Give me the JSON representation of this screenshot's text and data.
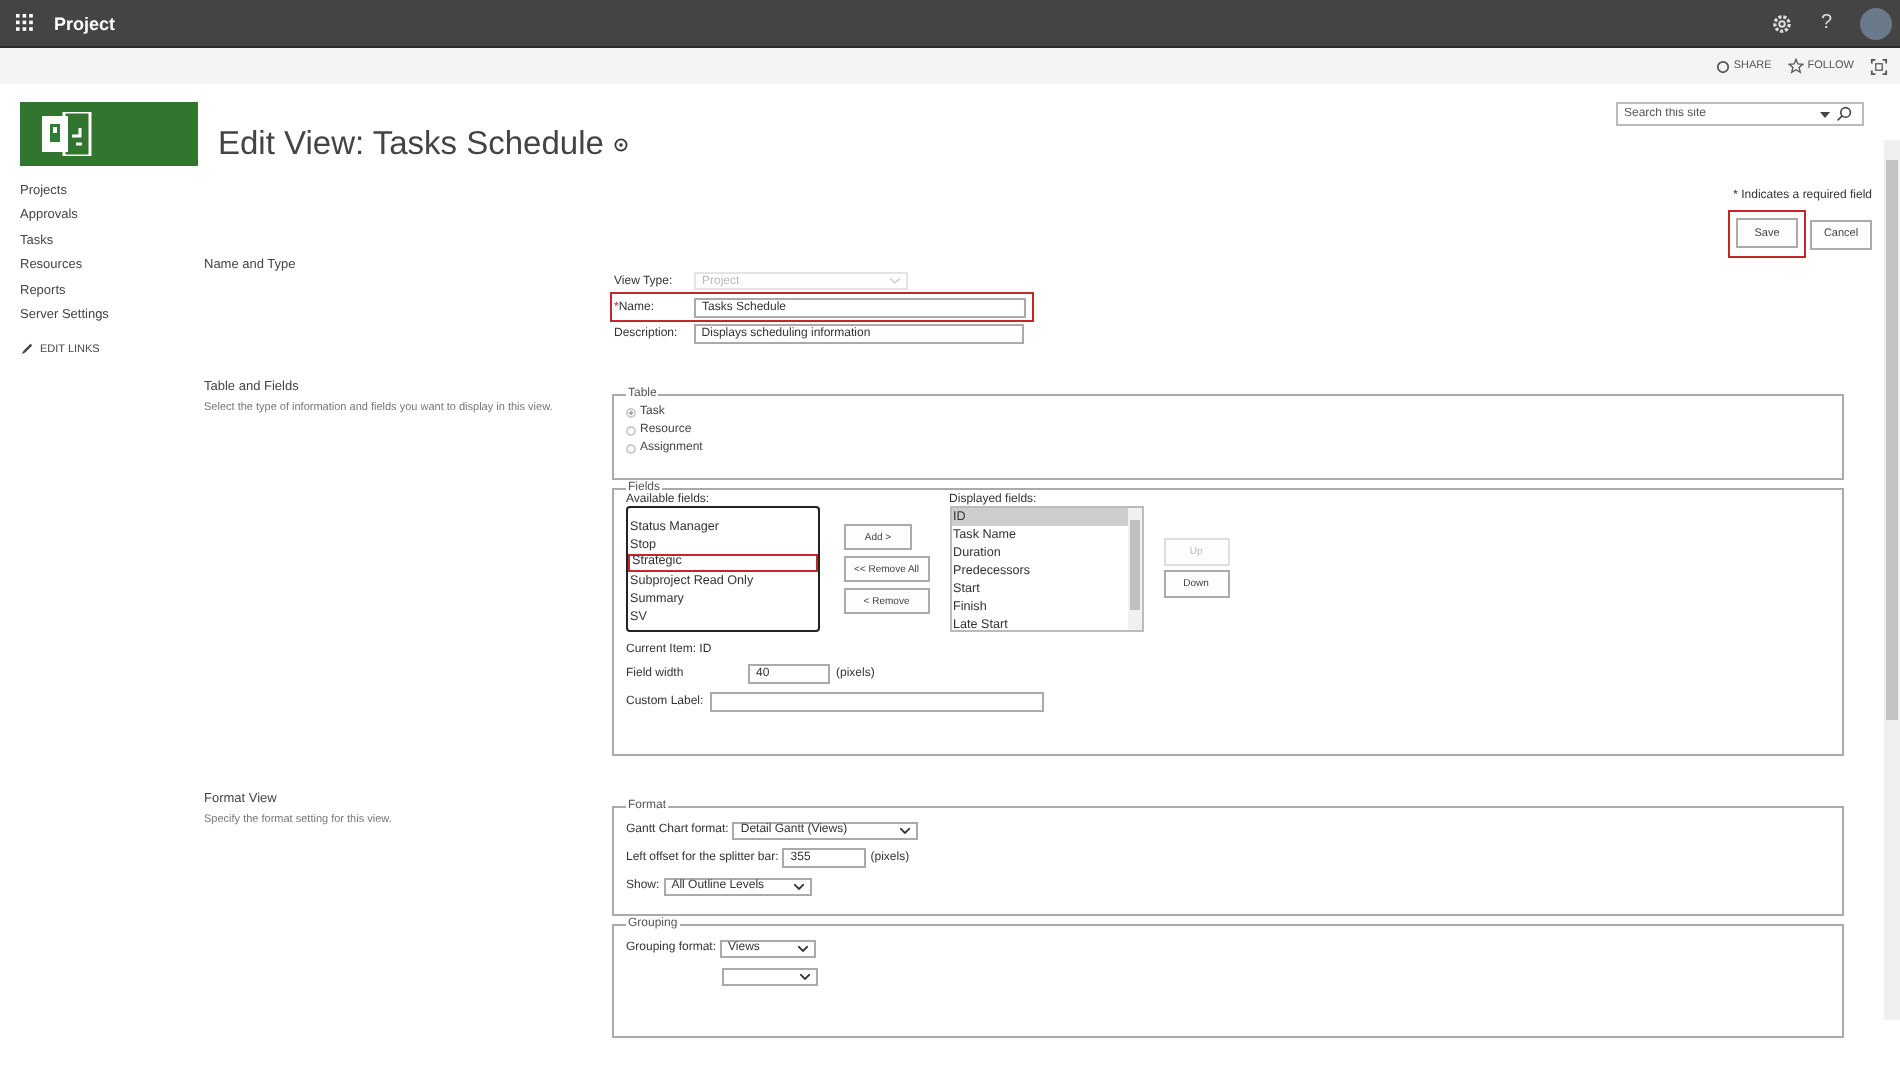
{
  "top_bar": {
    "app_name": "Project",
    "help_label": "?"
  },
  "suite_bar": {
    "actions": [
      {
        "kind": "share",
        "label": "SHARE"
      },
      {
        "kind": "follow",
        "label": "FOLLOW"
      },
      {
        "kind": "focus"
      }
    ]
  },
  "search": {
    "placeholder": "Search this site"
  },
  "page_title": "Edit View: Tasks Schedule",
  "nav": {
    "items": [
      "Projects",
      "Approvals",
      "Tasks",
      "Resources",
      "Reports",
      "Server Settings"
    ],
    "edit_links": "EDIT LINKS"
  },
  "required_note": "* Indicates a required field",
  "buttons": [
    {
      "label": "Save",
      "highlighted": true
    },
    {
      "label": "Cancel",
      "highlighted": false
    }
  ],
  "name_and_type": {
    "heading": "Name and Type",
    "view_type_label": "View Type:",
    "view_type_value": "Project",
    "view_type_disabled": true,
    "name_label": "Name:",
    "name_required_mark": "*",
    "name_value": "Tasks Schedule",
    "name_highlighted": true,
    "description_label": "Description:",
    "description_value": "Displays scheduling information"
  },
  "table_and_fields": {
    "heading": "Table and Fields",
    "description": "Select the type of information and fields you want to display in this view.",
    "table_legend": "Table",
    "table_options": [
      {
        "label": "Task",
        "selected": true
      },
      {
        "label": "Resource",
        "selected": false
      },
      {
        "label": "Assignment",
        "selected": false
      }
    ],
    "fields_legend": "Fields",
    "available_label": "Available fields:",
    "available_fields": [
      {
        "label": "Status Manager",
        "selected": false,
        "highlighted": false
      },
      {
        "label": "Stop",
        "selected": false,
        "highlighted": false
      },
      {
        "label": "Strategic",
        "selected": false,
        "highlighted": true
      },
      {
        "label": "Subproject Read Only",
        "selected": false,
        "highlighted": false
      },
      {
        "label": "Summary",
        "selected": false,
        "highlighted": false
      },
      {
        "label": "SV",
        "selected": false,
        "highlighted": false
      }
    ],
    "move_buttons": [
      "Add >",
      "<< Remove All",
      "< Remove"
    ],
    "displayed_label": "Displayed fields:",
    "displayed_fields": [
      {
        "label": "ID",
        "selected": true
      },
      {
        "label": "Task Name",
        "selected": false
      },
      {
        "label": "Duration",
        "selected": false
      },
      {
        "label": "Predecessors",
        "selected": false
      },
      {
        "label": "Start",
        "selected": false
      },
      {
        "label": "Finish",
        "selected": false
      },
      {
        "label": "Late Start",
        "selected": false
      }
    ],
    "order_buttons": [
      {
        "label": "Up",
        "disabled": true
      },
      {
        "label": "Down",
        "disabled": false
      }
    ],
    "current_item": "Current Item: ID",
    "field_width_label": "Field width",
    "field_width_value": "40",
    "field_width_unit": "(pixels)",
    "custom_label": "Custom Label:"
  },
  "format_view": {
    "heading": "Format View",
    "description": "Specify the format setting for this view.",
    "format_legend": "Format",
    "gantt_label": "Gantt Chart format:",
    "gantt_value": "Detail Gantt (Views)",
    "offset_label": "Left offset for the splitter bar:",
    "offset_value": "355",
    "offset_unit": "(pixels)",
    "show_label": "Show:",
    "show_value": "All Outline Levels",
    "grouping_legend": "Grouping",
    "grouping_label": "Grouping format:",
    "grouping_value": "Views"
  }
}
